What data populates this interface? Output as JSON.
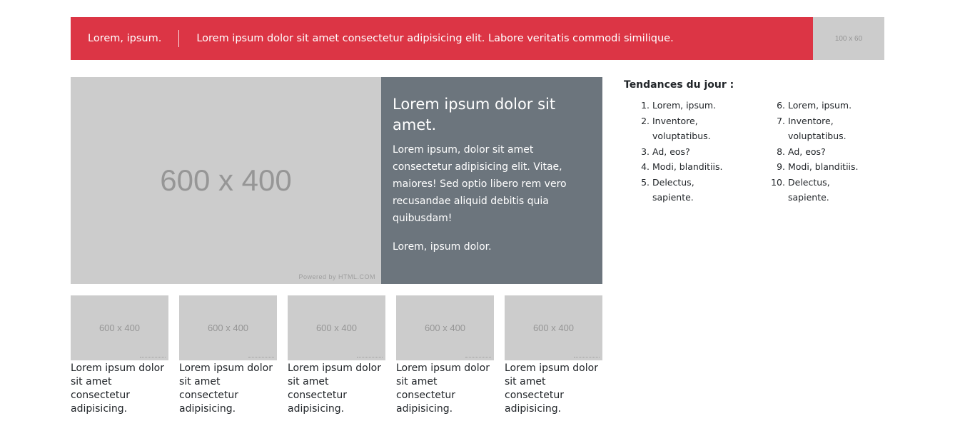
{
  "header": {
    "brand": "Lorem, ipsum.",
    "message": "Lorem ipsum dolor sit amet consectetur adipisicing elit. Labore veritatis commodi similique."
  },
  "ad": {
    "label": "100 x 60"
  },
  "hero": {
    "image_label": "600 x 400",
    "image_credit": "Powered by HTML.COM",
    "title": "Lorem ipsum dolor sit amet.",
    "text": "Lorem ipsum, dolor sit amet consectetur adipisicing elit. Vitae, maiores! Sed optio libero rem vero recusandae aliquid debitis quia quibusdam!",
    "small": "Lorem, ipsum dolor."
  },
  "thumbnails": [
    {
      "image_label": "600 x 400",
      "caption": "Lorem ipsum dolor sit amet consectetur adipisicing."
    },
    {
      "image_label": "600 x 400",
      "caption": "Lorem ipsum dolor sit amet consectetur adipisicing."
    },
    {
      "image_label": "600 x 400",
      "caption": "Lorem ipsum dolor sit amet consectetur adipisicing."
    },
    {
      "image_label": "600 x 400",
      "caption": "Lorem ipsum dolor sit amet consectetur adipisicing."
    },
    {
      "image_label": "600 x 400",
      "caption": "Lorem ipsum dolor sit amet consectetur adipisicing."
    }
  ],
  "trends": {
    "heading": "Tendances du jour :",
    "column1": [
      {
        "num": "1.",
        "label": "Lorem, ipsum."
      },
      {
        "num": "2.",
        "label": "Inventore, voluptatibus."
      },
      {
        "num": "3.",
        "label": "Ad, eos?"
      },
      {
        "num": "4.",
        "label": "Modi, blanditiis."
      },
      {
        "num": "5.",
        "label": "Delectus, sapiente."
      }
    ],
    "column2": [
      {
        "num": "6.",
        "label": "Lorem, ipsum."
      },
      {
        "num": "7.",
        "label": "Inventore, voluptatibus."
      },
      {
        "num": "8.",
        "label": "Ad, eos?"
      },
      {
        "num": "9.",
        "label": "Modi, blanditiis."
      },
      {
        "num": "10.",
        "label": "Delectus, sapiente."
      }
    ]
  },
  "colors": {
    "header_bg": "#dc3545",
    "placeholder_bg": "#cccccc",
    "card_bg": "#6c757d"
  }
}
